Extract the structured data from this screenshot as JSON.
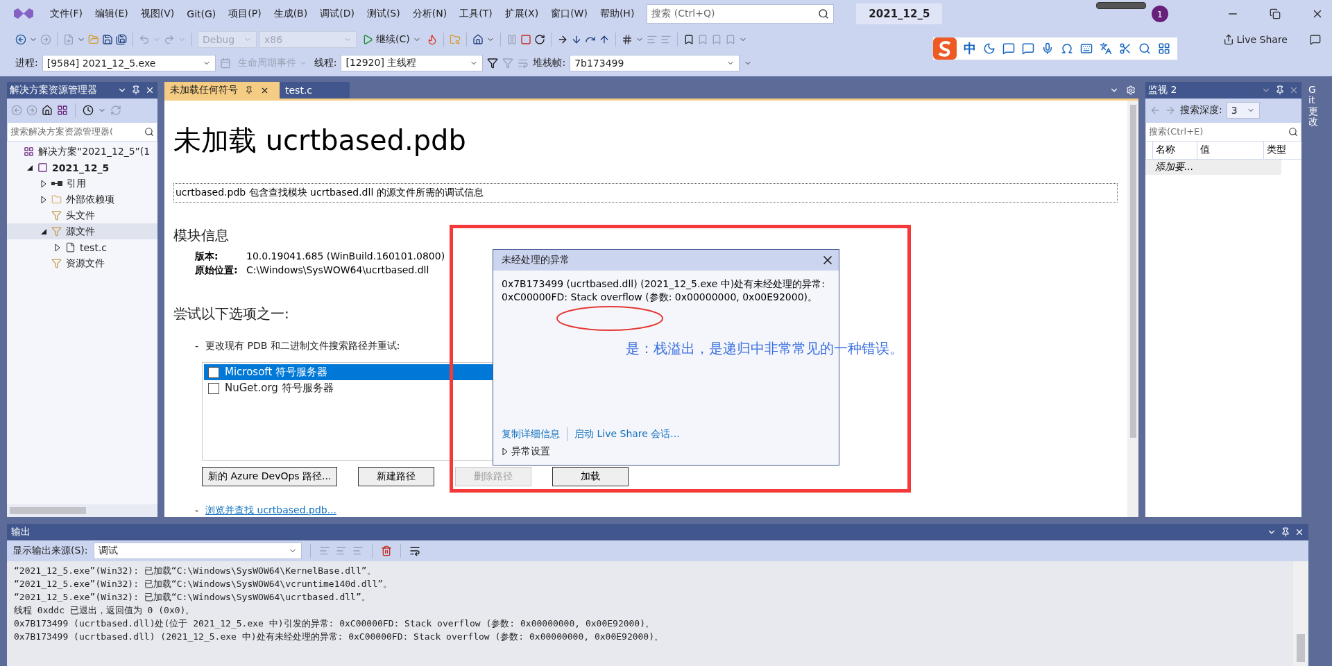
{
  "menu": [
    "文件(F)",
    "编辑(E)",
    "视图(V)",
    "Git(G)",
    "项目(P)",
    "生成(B)",
    "调试(D)",
    "测试(S)",
    "分析(N)",
    "工具(T)",
    "扩展(X)",
    "窗口(W)",
    "帮助(H)"
  ],
  "search": {
    "placeholder": "搜索 (Ctrl+Q)"
  },
  "solution_name": "2021_12_5",
  "account_badge": "1",
  "toolbar": {
    "config": {
      "value": "Debug",
      "disabled": true
    },
    "platform": {
      "value": "x86",
      "disabled": true
    },
    "continue": "继续(C)",
    "live_share": "Live Share"
  },
  "debug_bar": {
    "process_label": "进程:",
    "process": "[9584] 2021_12_5.exe",
    "lifecycle": {
      "label": "生命周期事件",
      "disabled": true
    },
    "thread_label": "线程:",
    "thread": "[12920] 主线程",
    "stack_label": "堆栈帧:",
    "stack": "7b173499"
  },
  "ime_toolbar": {
    "mode": "中"
  },
  "solution_explorer": {
    "title": "解决方案资源管理器",
    "search_placeholder": "搜索解决方案资源管理器(",
    "tree": [
      {
        "label": "解决方案“2021_12_5”(1",
        "kind": "solution",
        "selected": false,
        "children": [
          {
            "label": "2021_12_5",
            "kind": "project",
            "expanded": true,
            "selected": false,
            "children": [
              {
                "label": "引用",
                "kind": "references",
                "expanded": false,
                "selected": false
              },
              {
                "label": "外部依赖项",
                "kind": "folder",
                "expanded": false,
                "selected": false
              },
              {
                "label": "头文件",
                "kind": "filter",
                "selected": false
              },
              {
                "label": "源文件",
                "kind": "filter",
                "expanded": true,
                "selected": true,
                "children": [
                  {
                    "label": "test.c",
                    "kind": "file",
                    "expanded": false,
                    "selected": false
                  }
                ]
              },
              {
                "label": "资源文件",
                "kind": "filter",
                "selected": false
              }
            ]
          }
        ]
      }
    ]
  },
  "doc_tabs": [
    {
      "label": "未加载任何符号",
      "selected": true
    },
    {
      "label": "test.c",
      "selected": false
    }
  ],
  "document": {
    "heading": "未加载 ucrtbased.pdb",
    "description": "ucrtbased.pdb 包含查找模块 ucrtbased.dll 的源文件所需的调试信息",
    "module_info_title": "模块信息",
    "fields": [
      {
        "label": "版本:",
        "value": "10.0.19041.685 (WinBuild.160101.0800)"
      },
      {
        "label": "原始位置:",
        "value": "C:\\Windows\\SysWOW64\\ucrtbased.dll"
      }
    ],
    "options_title": "尝试以下选项之一:",
    "option_dash": "-",
    "option_text": "更改现有 PDB 和二进制文件搜索路径并重试:",
    "symbol_servers": [
      {
        "label": "Microsoft 符号服务器",
        "checked": false,
        "selected": true
      },
      {
        "label": "NuGet.org 符号服务器",
        "checked": false,
        "selected": false
      }
    ],
    "buttons": [
      {
        "label": "新的 Azure DevOps 路径...",
        "disabled": false
      },
      {
        "label": "新建路径",
        "disabled": false
      },
      {
        "label": "删除路径",
        "disabled": true
      },
      {
        "label": "加载",
        "disabled": false
      }
    ],
    "browse_dash": "-",
    "browse_link": "浏览并查找 ucrtbased.pdb..."
  },
  "exception_dialog": {
    "title": "未经处理的异常",
    "message": "0x7B173499 (ucrtbased.dll) (2021_12_5.exe 中)处有未经处理的异常: 0xC00000FD: Stack overflow (参数: 0x00000000, 0x00E92000)。",
    "links": [
      "复制详细信息",
      "启动 Live Share 会话..."
    ],
    "settings": {
      "label": "异常设置",
      "expanded": false
    }
  },
  "annotation": {
    "note": "是：栈溢出，是递归中非常常见的一种错误。"
  },
  "watch": {
    "title": "监视 2",
    "depth_label": "搜索深度:",
    "depth": "3",
    "search_placeholder": "搜索(Ctrl+E)",
    "columns": [
      "名称",
      "值",
      "类型"
    ],
    "add_row": "添加要..."
  },
  "side_tab": "Git 更改",
  "output": {
    "title": "输出",
    "source_label": "显示输出来源(S):",
    "source": "调试",
    "lines": [
      "“2021_12_5.exe”(Win32): 已加载“C:\\Windows\\SysWOW64\\KernelBase.dll”。",
      "“2021_12_5.exe”(Win32): 已加载“C:\\Windows\\SysWOW64\\vcruntime140d.dll”。",
      "“2021_12_5.exe”(Win32): 已加载“C:\\Windows\\SysWOW64\\ucrtbased.dll”。",
      "线程 0xddc 已退出，返回值为 0 (0x0)。",
      "0x7B173499 (ucrtbased.dll)处(位于 2021_12_5.exe 中)引发的异常: 0xC00000FD: Stack overflow (参数: 0x00000000, 0x00E92000)。",
      "0x7B173499 (ucrtbased.dll) (2021_12_5.exe 中)处有未经处理的异常: 0xC00000FD: Stack overflow (参数: 0x00000000, 0x00E92000)。"
    ]
  }
}
